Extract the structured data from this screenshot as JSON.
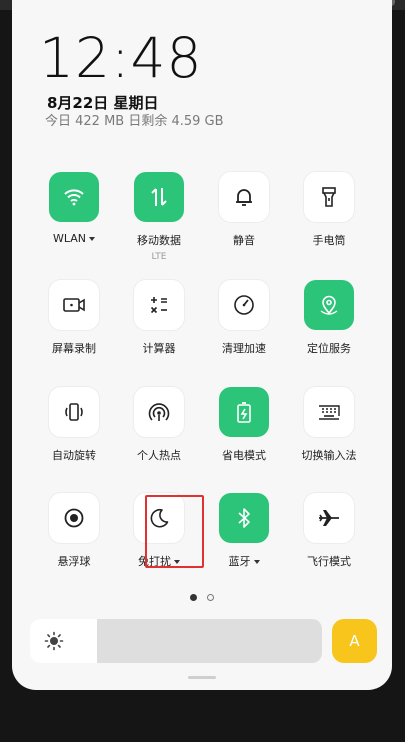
{
  "header": {
    "time": "12:48",
    "date": "8月22日  星期日",
    "usage": "今日 422 MB 日剩余 4.59 GB"
  },
  "tiles": [
    {
      "label": "WLAN",
      "icon": "wifi-icon",
      "active": true,
      "dropdown": true
    },
    {
      "label": "移动数据",
      "sub": "LTE",
      "icon": "mobile-data-icon",
      "active": true
    },
    {
      "label": "静音",
      "icon": "bell-icon",
      "active": false
    },
    {
      "label": "手电筒",
      "icon": "flashlight-icon",
      "active": false
    },
    {
      "label": "屏幕录制",
      "icon": "screen-record-icon",
      "active": false
    },
    {
      "label": "计算器",
      "icon": "calculator-icon",
      "active": false
    },
    {
      "label": "清理加速",
      "icon": "speedometer-icon",
      "active": false
    },
    {
      "label": "定位服务",
      "icon": "location-icon",
      "active": true
    },
    {
      "label": "自动旋转",
      "icon": "rotate-icon",
      "active": false
    },
    {
      "label": "个人热点",
      "icon": "hotspot-icon",
      "active": false
    },
    {
      "label": "省电模式",
      "icon": "battery-saver-icon",
      "active": true
    },
    {
      "label": "切换输入法",
      "icon": "keyboard-icon",
      "active": false
    },
    {
      "label": "悬浮球",
      "icon": "floating-ball-icon",
      "active": false
    },
    {
      "label": "免打扰",
      "icon": "moon-icon",
      "active": false,
      "dropdown": true,
      "highlighted": true
    },
    {
      "label": "蓝牙",
      "icon": "bluetooth-icon",
      "active": true,
      "dropdown": true
    },
    {
      "label": "飞行模式",
      "icon": "airplane-icon",
      "active": false
    }
  ],
  "pager": {
    "current": 1,
    "total": 2
  },
  "brightness": {
    "level": 0.23,
    "icon": "sun-icon"
  },
  "auto_brightness": {
    "label": "A"
  },
  "colors": {
    "accent": "#2cc479",
    "auto": "#f7c51c",
    "highlight": "#e23131"
  }
}
